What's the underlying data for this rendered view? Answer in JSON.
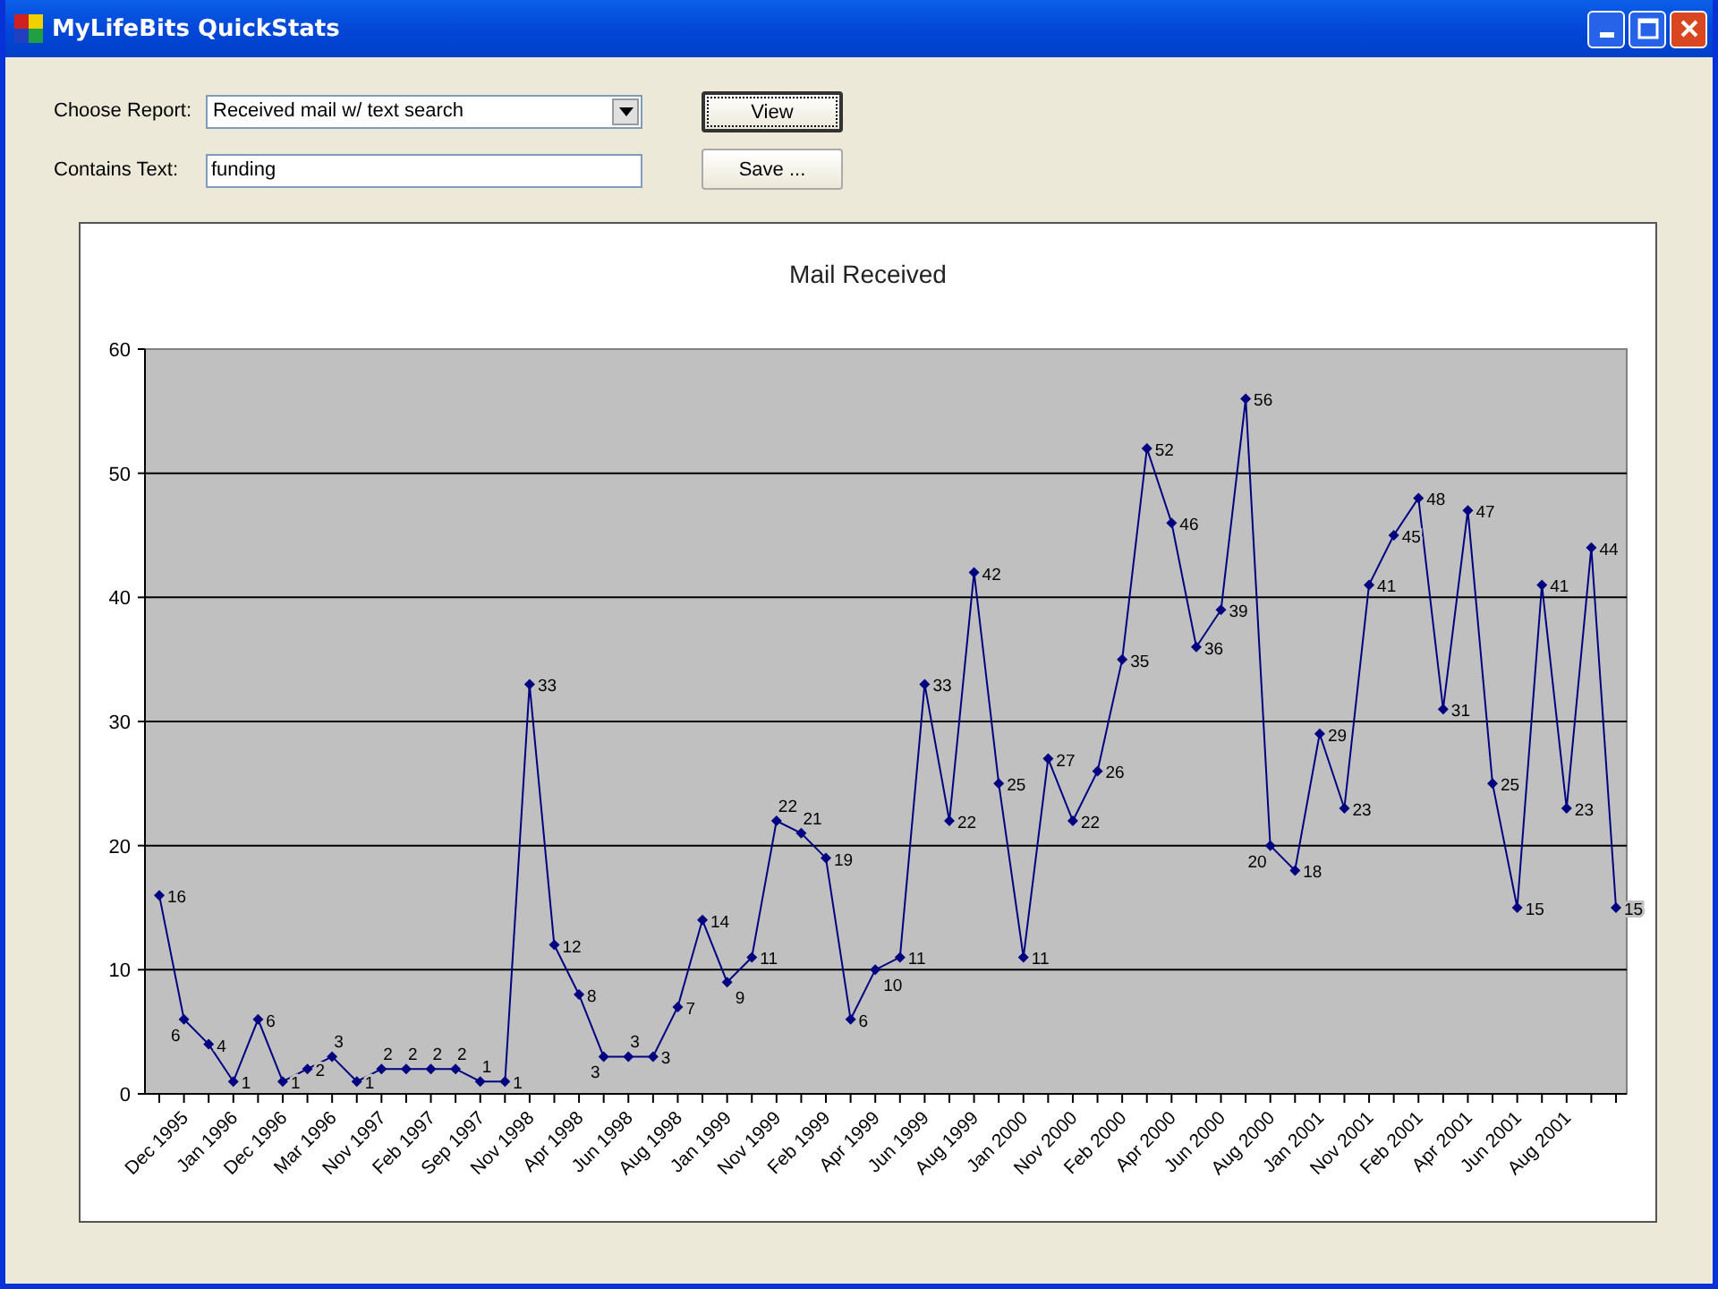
{
  "window": {
    "title": "MyLifeBits QuickStats"
  },
  "form": {
    "report_label": "Choose Report:",
    "report_value": "Received mail w/ text search",
    "text_label": "Contains Text:",
    "text_value": "funding"
  },
  "buttons": [
    {
      "label": "View",
      "focused": true
    },
    {
      "label": "Save ...",
      "focused": false
    }
  ],
  "chart": {
    "chart_data": {
      "type": "line",
      "title": "Mail Received",
      "categories": [
        null,
        "Dec 1995",
        null,
        "Jan 1996",
        null,
        "Dec 1996",
        null,
        "Mar 1996",
        null,
        "Nov 1997",
        null,
        "Feb 1997",
        null,
        "Sep 1997",
        null,
        "Nov 1998",
        null,
        "Apr 1998",
        null,
        "Jun 1998",
        null,
        "Aug 1998",
        null,
        "Jan 1999",
        null,
        "Nov 1999",
        null,
        "Feb 1999",
        null,
        "Apr 1999",
        null,
        "Jun 1999",
        null,
        "Aug 1999",
        null,
        "Jan 2000",
        null,
        "Nov 2000",
        null,
        "Feb 2000",
        null,
        "Apr 2000",
        null,
        "Jun 2000",
        null,
        "Aug 2000",
        null,
        "Jan 2001",
        null,
        "Nov 2001",
        null,
        "Feb 2001",
        null,
        "Apr 2001",
        null,
        "Jun 2001",
        null,
        "Aug 2001",
        null,
        null
      ],
      "series": [
        {
          "color": "#000080",
          "marker": "diamond",
          "values": [
            16,
            6,
            4,
            1,
            6,
            1,
            2,
            3,
            1,
            2,
            2,
            2,
            2,
            1,
            1,
            33,
            12,
            8,
            3,
            3,
            3,
            7,
            14,
            9,
            11,
            22,
            21,
            19,
            6,
            10,
            11,
            33,
            22,
            42,
            25,
            11,
            27,
            22,
            26,
            35,
            52,
            46,
            36,
            39,
            56,
            20,
            18,
            29,
            23,
            41,
            45,
            48,
            31,
            47,
            25,
            15,
            41,
            23,
            44,
            15
          ]
        }
      ],
      "ylim": [
        0,
        60
      ],
      "yticks": [
        0,
        10,
        20,
        30,
        40,
        50,
        60
      ],
      "data_labels": true,
      "grid": true
    }
  }
}
